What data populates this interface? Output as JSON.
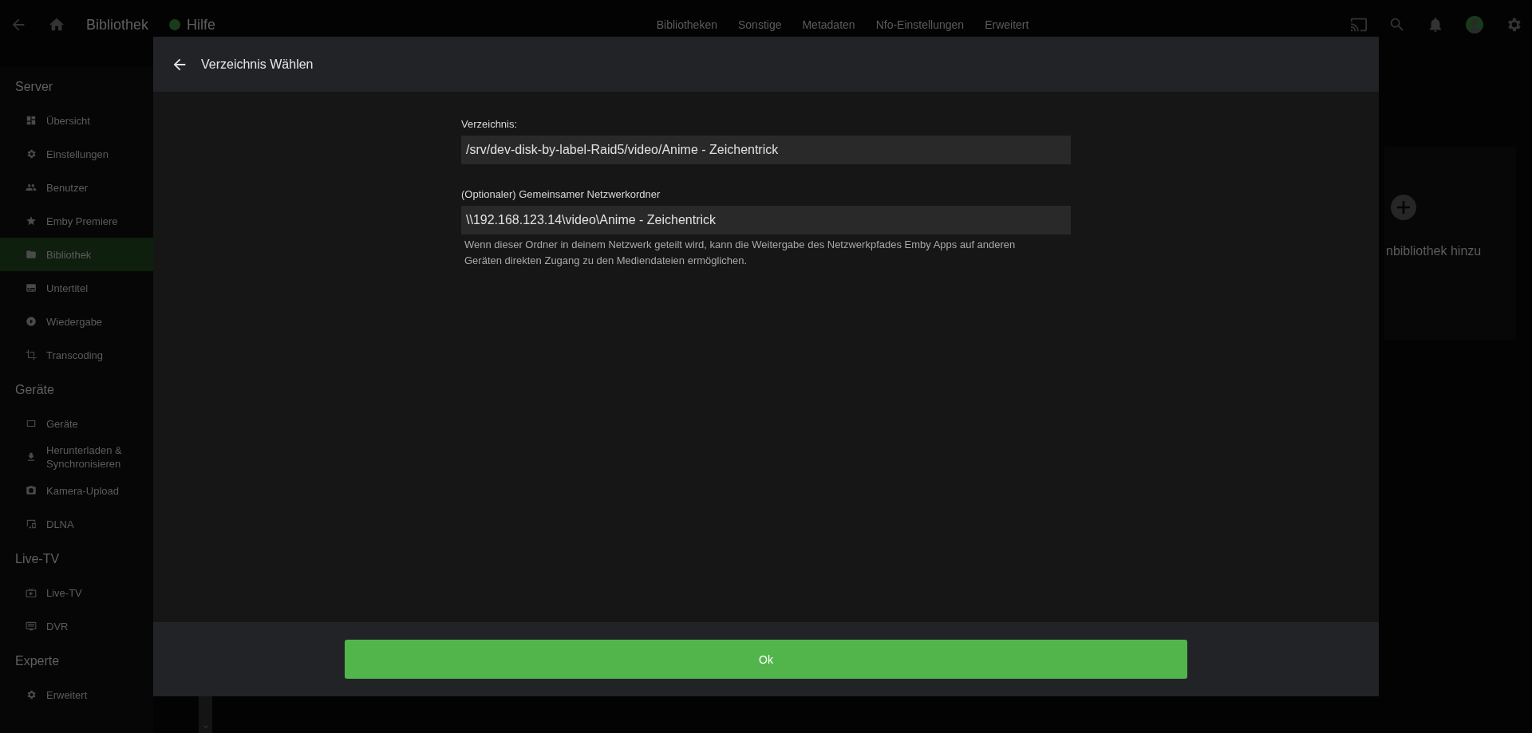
{
  "topbar": {
    "title": "Bibliothek",
    "help": "Hilfe",
    "tabs": [
      {
        "label": "Bibliotheken"
      },
      {
        "label": "Sonstige"
      },
      {
        "label": "Metadaten"
      },
      {
        "label": "Nfo-Einstellungen"
      },
      {
        "label": "Erweitert"
      }
    ]
  },
  "sidebar": {
    "sections": [
      {
        "title": "Server",
        "items": [
          {
            "label": "Übersicht",
            "selected": false
          },
          {
            "label": "Einstellungen",
            "selected": false
          },
          {
            "label": "Benutzer",
            "selected": false
          },
          {
            "label": "Emby Premiere",
            "selected": false
          },
          {
            "label": "Bibliothek",
            "selected": true
          },
          {
            "label": "Untertitel",
            "selected": false
          },
          {
            "label": "Wiedergabe",
            "selected": false
          },
          {
            "label": "Transcoding",
            "selected": false
          }
        ]
      },
      {
        "title": "Geräte",
        "items": [
          {
            "label": "Geräte",
            "selected": false
          },
          {
            "label": "Herunterladen & Synchronisieren",
            "selected": false
          },
          {
            "label": "Kamera-Upload",
            "selected": false
          },
          {
            "label": "DLNA",
            "selected": false
          }
        ]
      },
      {
        "title": "Live-TV",
        "items": [
          {
            "label": "Live-TV",
            "selected": false
          },
          {
            "label": "DVR",
            "selected": false
          }
        ]
      },
      {
        "title": "Experte",
        "items": [
          {
            "label": "Erweitert",
            "selected": false
          }
        ]
      }
    ]
  },
  "add_card": {
    "label": "nbibliothek hinzu"
  },
  "dialog": {
    "title": "Verzeichnis Wählen",
    "fields": [
      {
        "label": "Verzeichnis:",
        "value": "/srv/dev-disk-by-label-Raid5/video/Anime - Zeichentrick"
      },
      {
        "label": "(Optionaler) Gemeinsamer Netzwerkordner",
        "value": "\\\\192.168.123.14\\video\\Anime - Zeichentrick",
        "help": "Wenn dieser Ordner in deinem Netzwerk geteilt wird, kann die Weitergabe des Netzwerkpfades Emby Apps auf anderen Geräten direkten Zugang zu den Mediendateien ermöglichen."
      }
    ],
    "button": "Ok"
  }
}
